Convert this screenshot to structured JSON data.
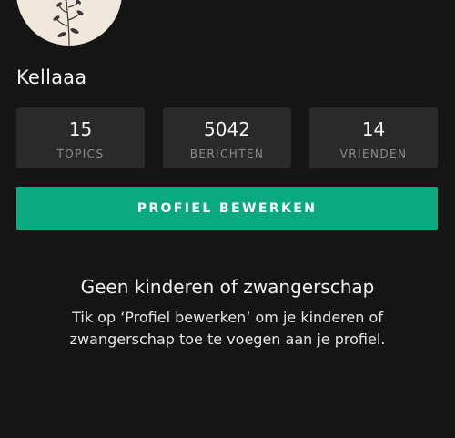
{
  "profile": {
    "username": "Kellaaa"
  },
  "stats": [
    {
      "value": "15",
      "label": "TOPICS"
    },
    {
      "value": "5042",
      "label": "BERICHTEN"
    },
    {
      "value": "14",
      "label": "VRIENDEN"
    }
  ],
  "actions": {
    "edit_profile_label": "PROFIEL BEWERKEN"
  },
  "empty_state": {
    "title": "Geen kinderen of zwangerschap",
    "description": "Tik op ‘Profiel bewerken’ om je kinderen of zwangerschap toe te voegen aan je profiel."
  },
  "colors": {
    "background": "#151515",
    "card": "#2a2a2a",
    "accent": "#0aa97f",
    "avatar_bg": "#f1e8dc"
  }
}
